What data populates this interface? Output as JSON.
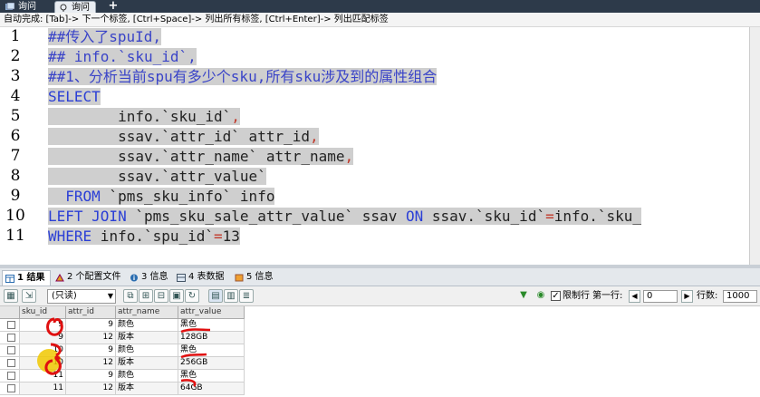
{
  "window": {
    "tabs": [
      {
        "label": "询问",
        "active": false
      },
      {
        "label": "询问",
        "active": true
      }
    ],
    "add_tab_label": "+"
  },
  "autocomplete_hint": "自动完成: [Tab]-> 下一个标签, [Ctrl+Space]-> 列出所有标签, [Ctrl+Enter]-> 列出匹配标签",
  "editor": {
    "lines": [
      {
        "num": "1",
        "tokens": [
          {
            "t": "##传入了spuId,",
            "c": "cm"
          }
        ]
      },
      {
        "num": "2",
        "tokens": [
          {
            "t": "## info.`sku_id`,",
            "c": "cm"
          }
        ]
      },
      {
        "num": "3",
        "tokens": [
          {
            "t": "##1、分析当前spu有多少个sku,所有sku涉及到的属性组合",
            "c": "cm"
          }
        ]
      },
      {
        "num": "4",
        "tokens": [
          {
            "t": "SELECT",
            "c": "kw"
          }
        ]
      },
      {
        "num": "5",
        "tokens": [
          {
            "t": "        info.`sku_id`",
            "c": "tx"
          },
          {
            "t": ",",
            "c": "nm"
          }
        ]
      },
      {
        "num": "6",
        "tokens": [
          {
            "t": "        ssav.`attr_id` attr_id",
            "c": "tx"
          },
          {
            "t": ",",
            "c": "nm"
          }
        ]
      },
      {
        "num": "7",
        "tokens": [
          {
            "t": "        ssav.`attr_name` attr_name",
            "c": "tx"
          },
          {
            "t": ",",
            "c": "nm"
          }
        ]
      },
      {
        "num": "8",
        "tokens": [
          {
            "t": "        ssav.`attr_value`",
            "c": "tx"
          }
        ]
      },
      {
        "num": "9",
        "tokens": [
          {
            "t": "  FROM",
            "c": "kw"
          },
          {
            "t": " `pms_sku_info` info",
            "c": "tx"
          }
        ]
      },
      {
        "num": "10",
        "tokens": [
          {
            "t": "LEFT JOIN",
            "c": "kw"
          },
          {
            "t": " `pms_sku_sale_attr_value` ssav ",
            "c": "tx"
          },
          {
            "t": "ON",
            "c": "kw"
          },
          {
            "t": " ssav.`sku_id`",
            "c": "tx"
          },
          {
            "t": "=",
            "c": "nm"
          },
          {
            "t": "info.`sku_",
            "c": "tx"
          }
        ]
      },
      {
        "num": "11",
        "tokens": [
          {
            "t": "WHERE",
            "c": "kw"
          },
          {
            "t": " info.`spu_id`",
            "c": "tx"
          },
          {
            "t": "=",
            "c": "nm"
          },
          {
            "t": "13",
            "c": "tx"
          }
        ]
      }
    ]
  },
  "result_tabs": [
    {
      "label": "1 结果",
      "active": true,
      "icon": "table-icon"
    },
    {
      "label": "2 个配置文件",
      "active": false,
      "icon": "profile-icon"
    },
    {
      "label": "3 信息",
      "active": false,
      "icon": "info-icon"
    },
    {
      "label": "4 表数据",
      "active": false,
      "icon": "table-data-icon"
    },
    {
      "label": "5 信息",
      "active": false,
      "icon": "info-icon"
    }
  ],
  "result_toolbar": {
    "mode": "(只读)",
    "limit_label": "限制行",
    "limit_checked": true,
    "first_row_label": "第一行:",
    "first_row_value": "0",
    "rows_label": "行数:",
    "rows_value": "1000"
  },
  "grid": {
    "columns": [
      "sku_id",
      "attr_id",
      "attr_name",
      "attr_value"
    ],
    "rows": [
      [
        "9",
        "9",
        "颜色",
        "黑色"
      ],
      [
        "9",
        "12",
        "版本",
        "128GB"
      ],
      [
        "10",
        "9",
        "颜色",
        "黑色"
      ],
      [
        "10",
        "12",
        "版本",
        "256GB"
      ],
      [
        "11",
        "9",
        "颜色",
        "黑色"
      ],
      [
        "11",
        "12",
        "版本",
        "64GB"
      ]
    ]
  },
  "colors": {
    "keyword": "#2b3fd6",
    "comment": "#3a44c8",
    "selection": "#cfcfcf",
    "ink_annotation": "#e01010",
    "highlight": "#f0c800"
  }
}
